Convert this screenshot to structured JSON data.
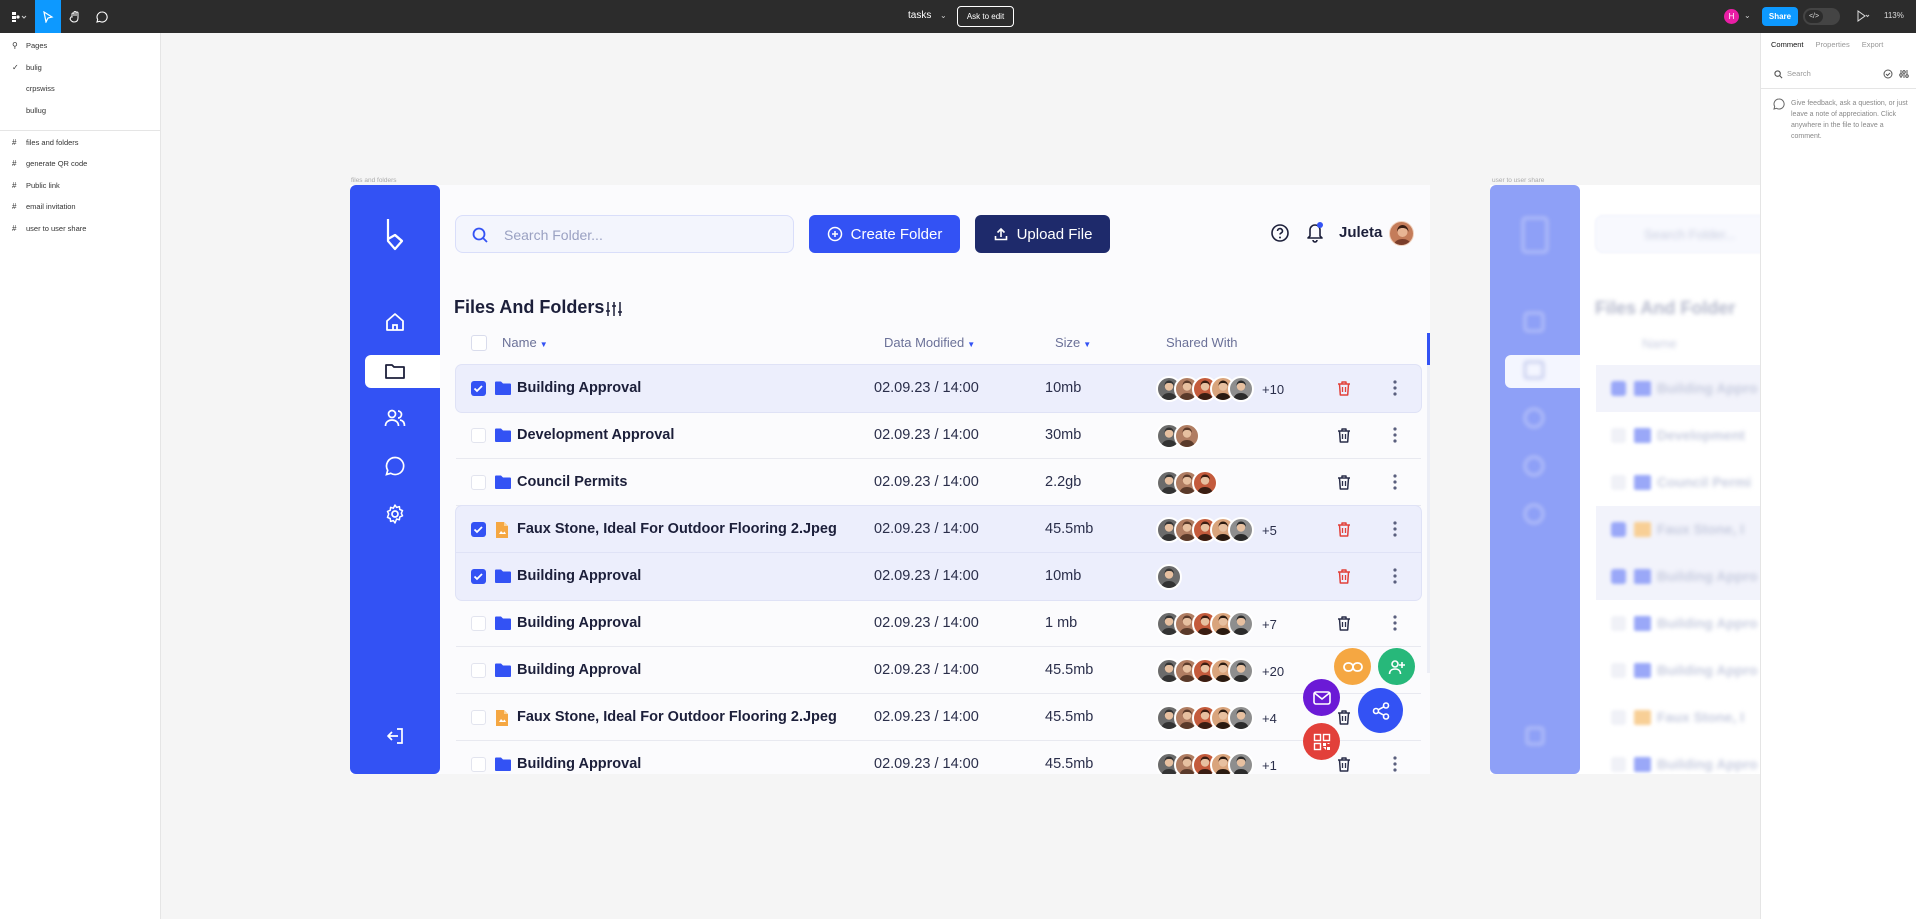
{
  "figma": {
    "title": "tasks",
    "ask_to_edit": "Ask to edit",
    "user_initial": "H",
    "share_label": "Share",
    "zoom": "113%",
    "pages_label": "Pages",
    "pages": [
      "bulig",
      "crpswiss",
      "bullug"
    ],
    "frames": [
      "files and folders",
      "generate QR code",
      "Public link",
      "email invitation",
      "user to user share"
    ],
    "right_tabs": [
      "Comment",
      "Properties",
      "Export"
    ],
    "search_placeholder": "Search",
    "comment_hint": "Give feedback, ask a question, or just leave a note of appreciation. Click anywhere in the file to leave a comment.",
    "frame_label_1": "files and folders",
    "frame_label_2": "user to user share",
    "accent": "#0d99ff"
  },
  "app": {
    "search_placeholder": "Search Folder...",
    "create_folder": "Create Folder",
    "upload_file": "Upload File",
    "user_name": "Juleta",
    "heading": "Files And Folders",
    "columns": {
      "name": "Name",
      "date": "Data Modified",
      "size": "Size",
      "shared": "Shared With"
    },
    "accent": "#3352f4",
    "rows": [
      {
        "name": "Building Approval",
        "date": "02.09.23 / 14:00",
        "size": "10mb",
        "more": "+10",
        "selected": true,
        "type": "folder",
        "avatars": 5
      },
      {
        "name": "Development Approval",
        "date": "02.09.23 / 14:00",
        "size": "30mb",
        "more": "",
        "selected": false,
        "type": "folder",
        "avatars": 2
      },
      {
        "name": "Council Permits",
        "date": "02.09.23 / 14:00",
        "size": "2.2gb",
        "more": "",
        "selected": false,
        "type": "folder",
        "avatars": 3
      },
      {
        "name": "Faux Stone, Ideal For Outdoor Flooring 2.Jpeg",
        "date": "02.09.23 / 14:00",
        "size": "45.5mb",
        "more": "+5",
        "selected": true,
        "type": "file",
        "avatars": 5
      },
      {
        "name": "Building Approval",
        "date": "02.09.23 / 14:00",
        "size": "10mb",
        "more": "",
        "selected": true,
        "type": "folder",
        "avatars": 1
      },
      {
        "name": "Building Approval",
        "date": "02.09.23 / 14:00",
        "size": "1 mb",
        "more": "+7",
        "selected": false,
        "type": "folder",
        "avatars": 5
      },
      {
        "name": "Building Approval",
        "date": "02.09.23 / 14:00",
        "size": "45.5mb",
        "more": "+20",
        "selected": false,
        "type": "folder",
        "avatars": 5
      },
      {
        "name": "Faux Stone, Ideal For Outdoor Flooring 2.Jpeg",
        "date": "02.09.23 / 14:00",
        "size": "45.5mb",
        "more": "+4",
        "selected": false,
        "type": "file",
        "avatars": 5
      },
      {
        "name": "Building Approval",
        "date": "02.09.23 / 14:00",
        "size": "45.5mb",
        "more": "+1",
        "selected": false,
        "type": "folder",
        "avatars": 5
      }
    ]
  },
  "frame2": {
    "search_placeholder": "Search Folder...",
    "heading": "Files And Folder",
    "name_col": "Name",
    "rows": [
      "Building Appro",
      "Development",
      "Council Permi",
      "Faux Stone, I",
      "Building Appro",
      "Building Appro",
      "Building Appro",
      "Faux Stone, I",
      "Building Appro"
    ]
  }
}
